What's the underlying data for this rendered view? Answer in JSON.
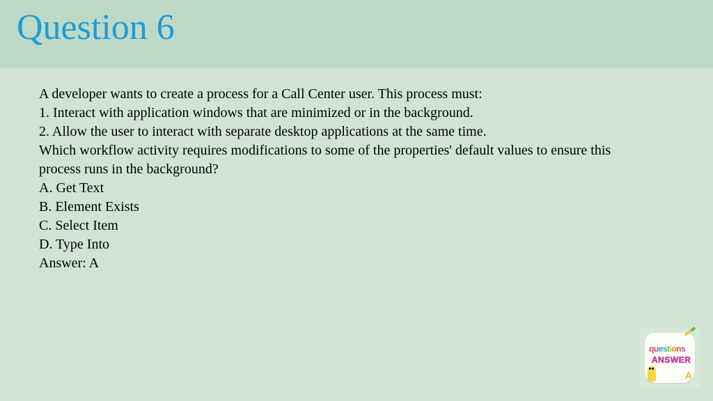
{
  "header": {
    "title": "Question 6"
  },
  "question": {
    "intro": "A developer wants to create a process for a Call Center user. This process must:",
    "req1": "1. Interact with application windows that are minimized or in the background.",
    "req2": "2. Allow the user to interact with separate desktop applications at the same time.",
    "prompt": "Which workflow activity requires modifications to some of the properties' default values to ensure this process runs in the background?",
    "optA": "A. Get Text",
    "optB": "B. Element Exists",
    "optC": "C. Select Item",
    "optD": "D. Type Into",
    "answer": "Answer: A"
  },
  "badge": {
    "line1": "questions",
    "line2": "ANSWER"
  }
}
